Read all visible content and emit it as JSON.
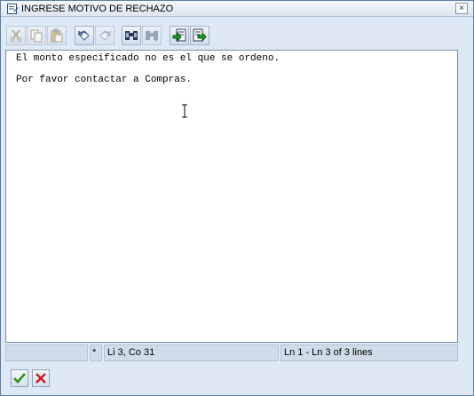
{
  "window": {
    "title": "INGRESE MOTIVO DE RECHAZO",
    "close_glyph": "×"
  },
  "toolbar": {
    "buttons": [
      {
        "name": "cut-icon",
        "enabled": false
      },
      {
        "name": "copy-icon",
        "enabled": false
      },
      {
        "name": "paste-icon",
        "enabled": false
      },
      {
        "name": "undo-icon",
        "enabled": true
      },
      {
        "name": "redo-icon",
        "enabled": false
      },
      {
        "name": "find-icon",
        "enabled": true
      },
      {
        "name": "find-next-icon",
        "enabled": false
      },
      {
        "name": "import-icon",
        "enabled": true
      },
      {
        "name": "export-icon",
        "enabled": true
      }
    ]
  },
  "editor": {
    "lines": [
      "El monto especificado no es el que se ordeno.",
      "",
      "Por favor contactar a Compras."
    ]
  },
  "status": {
    "cell1": "",
    "modified_marker": "*",
    "cursor": "Li 3, Co 31",
    "range": "Ln 1 - Ln 3 of 3 lines"
  },
  "actions": {
    "confirm": "confirm-icon",
    "cancel": "cancel-icon"
  },
  "colors": {
    "accent": "#dfe9f5",
    "confirm": "#2e8b1e",
    "cancel": "#c81e1e"
  }
}
